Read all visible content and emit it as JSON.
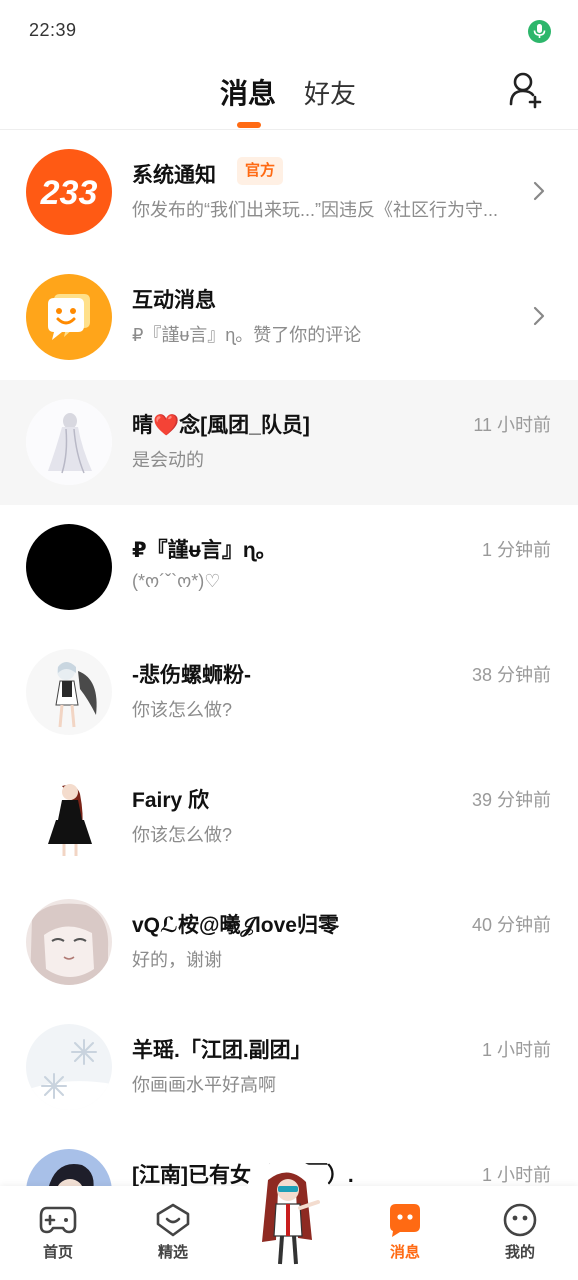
{
  "status_bar": {
    "time": "22:39"
  },
  "header": {
    "tabs": [
      {
        "label": "消息",
        "active": true
      },
      {
        "label": "好友",
        "active": false
      }
    ]
  },
  "conversations": [
    {
      "title": "系统通知",
      "badge": "官方",
      "preview": "你发布的“我们出来玩...”因违反《社区行为守...",
      "time": "",
      "avatar": "233-logo-icon"
    },
    {
      "title": "互动消息",
      "preview": "₽『謹ᵾ言』ɳ。赞了你的评论",
      "time": "",
      "avatar": "chat-bubble-icon"
    },
    {
      "title": "晴❤️念[風团_队员]",
      "preview": "是会动的",
      "time": "11 小时前",
      "avatar": "user-avatar"
    },
    {
      "title": "₽『謹ᵾ言』ɳ。",
      "preview": "(*ო´ˇ`ო*)♡",
      "time": "1 分钟前",
      "avatar": "user-avatar"
    },
    {
      "title": "-悲伤螺蛳粉-",
      "preview": "你该怎么做?",
      "time": "38 分钟前",
      "avatar": "user-avatar"
    },
    {
      "title": "Fairy  欣",
      "preview": "你该怎么做?",
      "time": "39 分钟前",
      "avatar": "user-avatar"
    },
    {
      "title": "vQℒ桉@曦𝒥love归零",
      "preview": "好的，谢谢",
      "time": "40 分钟前",
      "avatar": "user-avatar"
    },
    {
      "title": "羊瑶.「江团.副团」",
      "preview": "你画画水平好高啊",
      "time": "1 小时前",
      "avatar": "user-avatar"
    },
    {
      "title": "[江南]已有女（￣o￣）.",
      "preview": "",
      "time": "1 小时前",
      "avatar": "user-avatar"
    }
  ],
  "tabbar": {
    "items": [
      {
        "label": "首页",
        "icon": "gamepad-icon",
        "active": false
      },
      {
        "label": "精选",
        "icon": "heart-shield-icon",
        "active": false
      },
      {
        "label": "",
        "icon": "create-avatar",
        "active": false
      },
      {
        "label": "消息",
        "icon": "message-icon",
        "active": true
      },
      {
        "label": "我的",
        "icon": "smiley-icon",
        "active": false
      }
    ]
  },
  "colors": {
    "accent": "#ff6a13",
    "mic": "#2db66b",
    "highlight_row": "#f6f6f6"
  }
}
